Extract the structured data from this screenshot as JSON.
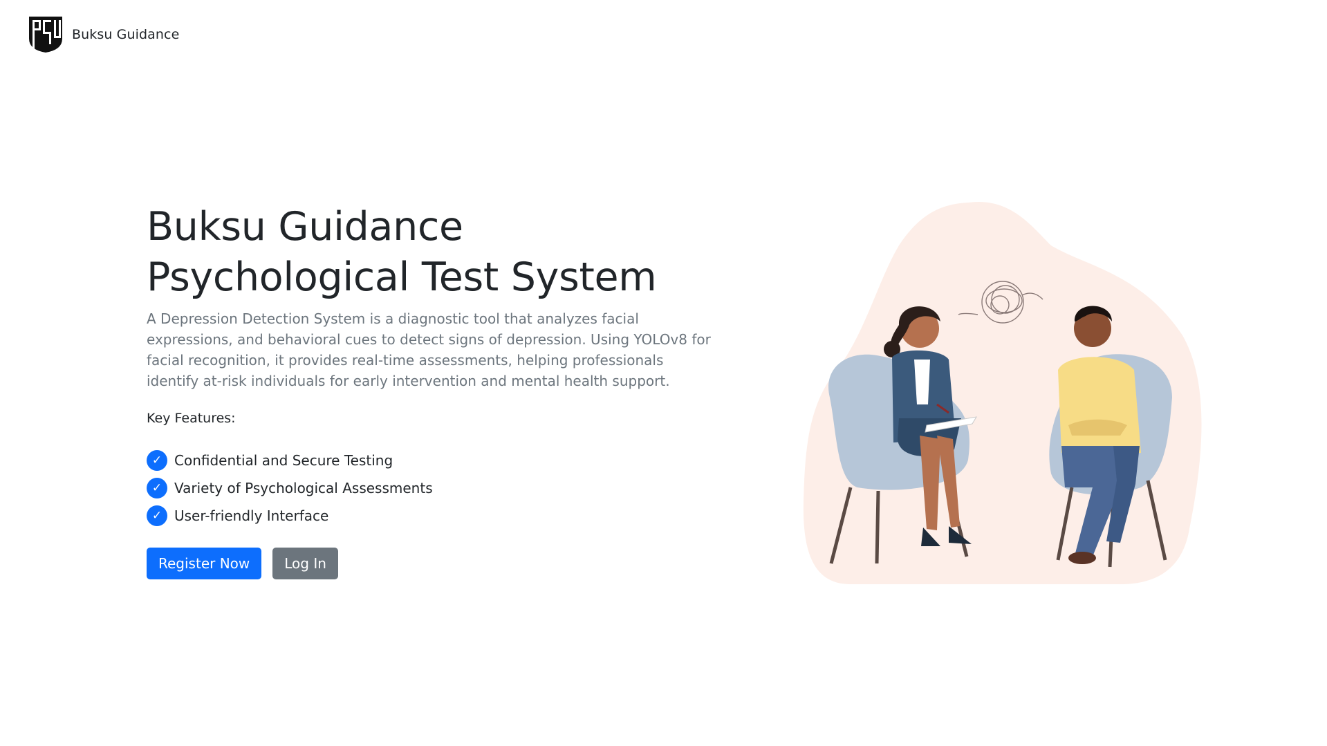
{
  "navbar": {
    "logo_icon": "buksu-shield-logo",
    "brand_name": "Buksu Guidance"
  },
  "hero": {
    "title_line1": "Buksu Guidance",
    "title_line2": "Psychological Test System",
    "description": "A Depression Detection System is a diagnostic tool that analyzes facial expressions, and behavioral cues to detect signs of depression. Using YOLOv8 for facial recognition, it provides real-time assessments, helping professionals identify at-risk individuals for early intervention and mental health support.",
    "features_heading": "Key Features:",
    "features": [
      {
        "icon": "check-circle-icon",
        "label": "Confidential and Secure Testing"
      },
      {
        "icon": "check-circle-icon",
        "label": "Variety of Psychological Assessments"
      },
      {
        "icon": "check-circle-icon",
        "label": "User-friendly Interface"
      }
    ],
    "check_glyph": "✓",
    "register_label": "Register Now",
    "login_label": "Log In"
  },
  "illustration": {
    "description_icon": "counseling-session-illustration"
  },
  "colors": {
    "primary": "#0d6efd",
    "secondary": "#6c757d",
    "text": "#212529",
    "muted": "#6c757d",
    "blob": "#fdeee8"
  }
}
